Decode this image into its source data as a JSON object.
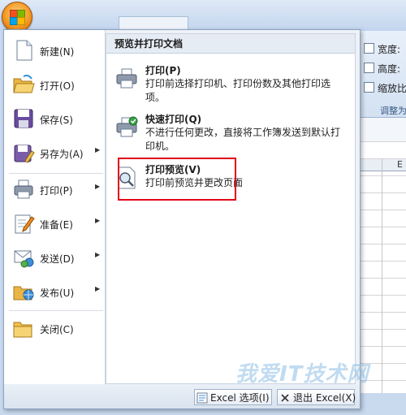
{
  "ribbon": {
    "width_label": "宽度:",
    "height_label": "高度:",
    "scale_label": "缩放比",
    "group_label": "调整为"
  },
  "sheet": {
    "column_header": "E"
  },
  "menu": {
    "commands": [
      {
        "label": "新建(N)",
        "has_submenu": false,
        "icon": "new-document-icon"
      },
      {
        "label": "打开(O)",
        "has_submenu": false,
        "icon": "open-folder-icon"
      },
      {
        "label": "保存(S)",
        "has_submenu": false,
        "icon": "save-disk-icon"
      },
      {
        "label": "另存为(A)",
        "has_submenu": true,
        "icon": "save-as-icon"
      },
      {
        "label": "打印(P)",
        "has_submenu": true,
        "icon": "printer-icon"
      },
      {
        "label": "准备(E)",
        "has_submenu": true,
        "icon": "prepare-icon"
      },
      {
        "label": "发送(D)",
        "has_submenu": true,
        "icon": "send-icon"
      },
      {
        "label": "发布(U)",
        "has_submenu": true,
        "icon": "publish-icon"
      },
      {
        "label": "关闭(C)",
        "has_submenu": false,
        "icon": "close-folder-icon"
      }
    ],
    "submenu_title": "预览并打印文档",
    "options": [
      {
        "title": "打印(P)",
        "desc": "打印前选择打印机、打印份数及其他打印选项。",
        "icon": "printer-icon"
      },
      {
        "title": "快速打印(Q)",
        "desc": "不进行任何更改，直接将工作簿发送到默认打印机。",
        "icon": "quick-print-icon"
      },
      {
        "title": "打印预览(V)",
        "desc": "打印前预览并更改页面",
        "icon": "print-preview-icon"
      }
    ],
    "excel_options_label": "Excel 选项(I)",
    "exit_label": "退出 Excel(X)"
  },
  "watermark": {
    "text": "我爱IT技术网",
    "subtext": ""
  },
  "colors": {
    "highlight": "#e2001a",
    "menu_border": "#8aa2c0"
  }
}
